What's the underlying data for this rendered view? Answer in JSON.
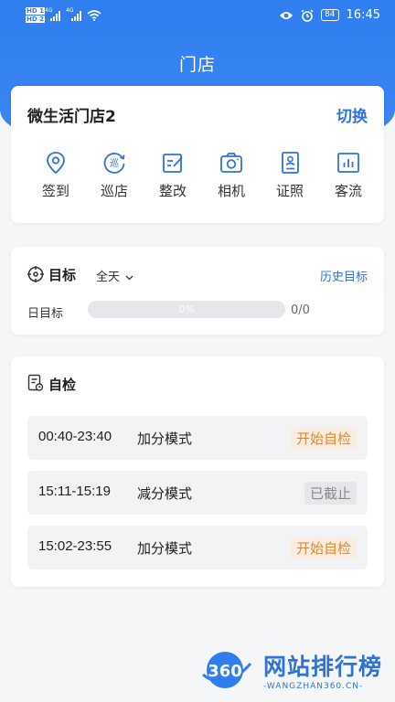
{
  "status_bar": {
    "hd1": "HD 1",
    "hd2": "HD 2",
    "net1": "4G",
    "net2": "4G",
    "battery": "84",
    "time": "16:45"
  },
  "header": {
    "title": "门店"
  },
  "store": {
    "name": "微生活门店2",
    "switch_label": "切换",
    "actions": [
      {
        "label": "签到",
        "icon": "location-pin-icon"
      },
      {
        "label": "巡店",
        "icon": "patrol-icon",
        "glyph": "巡"
      },
      {
        "label": "整改",
        "icon": "edit-document-icon"
      },
      {
        "label": "相机",
        "icon": "camera-icon"
      },
      {
        "label": "证照",
        "icon": "id-card-icon"
      },
      {
        "label": "客流",
        "icon": "bar-chart-icon"
      }
    ]
  },
  "target": {
    "title": "目标",
    "filter": "全天",
    "history_label": "历史目标",
    "daily_label": "日目标",
    "progress": 0,
    "progress_text": "0%",
    "count": "0/0"
  },
  "self_check": {
    "title": "自检",
    "rows": [
      {
        "time": "00:40-23:40",
        "mode": "加分模式",
        "status": "开始自检"
      },
      {
        "time": "15:11-15:19",
        "mode": "减分模式",
        "status": "已截止"
      },
      {
        "time": "15:02-23:55",
        "mode": "加分模式",
        "status": "开始自检"
      }
    ]
  },
  "watermark": {
    "logo_text": "360",
    "text": "网站排行榜",
    "subtext": "-WANGZHAN360.CN-"
  },
  "colors": {
    "primary": "#2f7ef0",
    "link": "#2f73d8",
    "warning": "#e28a2b"
  }
}
